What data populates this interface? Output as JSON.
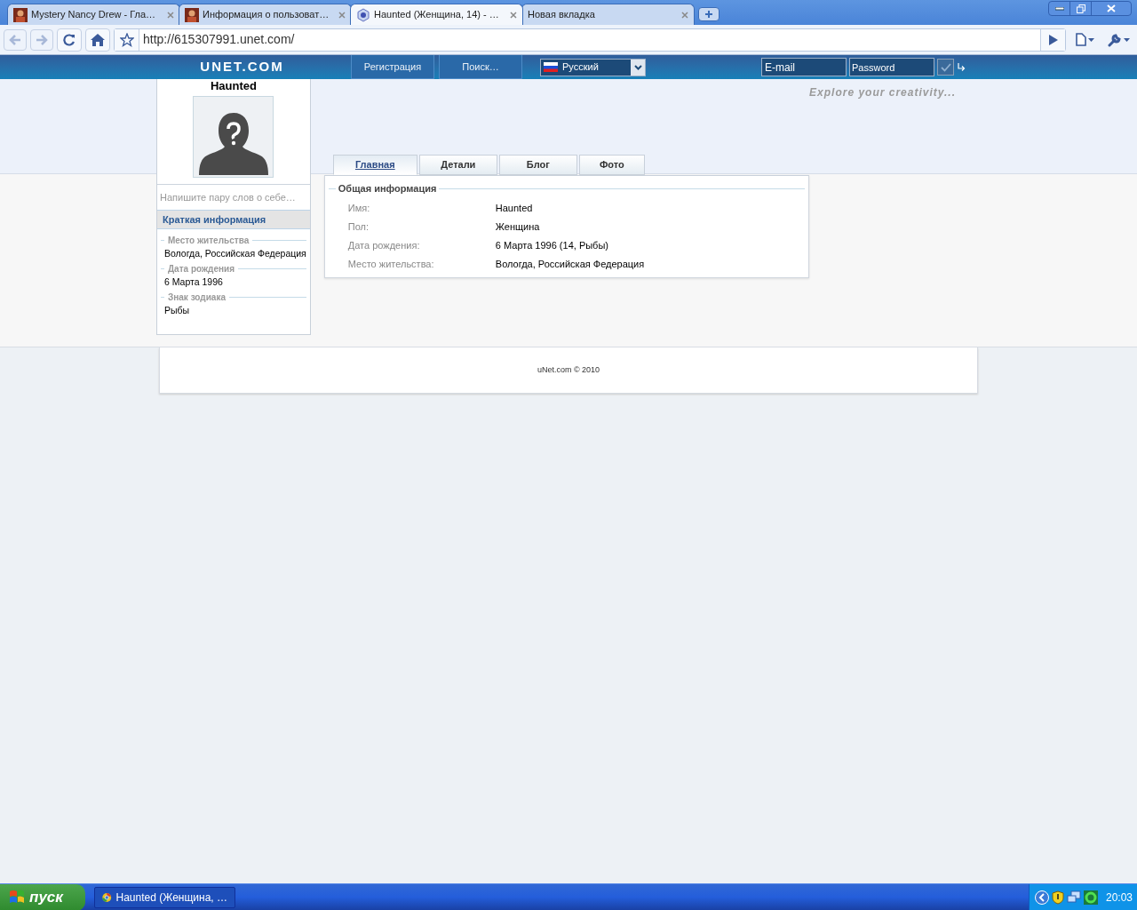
{
  "browser": {
    "tabs": [
      {
        "title": "Mystery Nancy Drew - Гла…",
        "kind": "portrait",
        "selected": false
      },
      {
        "title": "Информация о пользоват…",
        "kind": "portrait",
        "selected": false
      },
      {
        "title": "Haunted (Женщина, 14) - …",
        "kind": "site",
        "selected": true
      },
      {
        "title": "Новая вкладка",
        "kind": "blank",
        "selected": false
      }
    ],
    "url": "http://615307991.unet.com/"
  },
  "site": {
    "logo": "UNET.COM",
    "nav": [
      "Регистрация",
      "Поиск…"
    ],
    "language": "Русский",
    "email": {
      "placeholder": "E-mail"
    },
    "password": {
      "placeholder": "Password"
    },
    "slogan": "Explore your creativity..."
  },
  "profile": {
    "name": "Haunted",
    "about": {
      "placeholder": "Напишите пару слов о себе…"
    },
    "summary_title": "Краткая информация",
    "fields": [
      {
        "label": "Место жительства",
        "value": "Вологда, Российская Федерация"
      },
      {
        "label": "Дата рождения",
        "value": "6 Марта 1996"
      },
      {
        "label": "Знак зодиака",
        "value": "Рыбы"
      }
    ]
  },
  "tabs": [
    {
      "label": "Главная",
      "selected": true
    },
    {
      "label": "Детали",
      "selected": false
    },
    {
      "label": "Блог",
      "selected": false
    },
    {
      "label": "Фото",
      "selected": false
    }
  ],
  "section": {
    "title": "Общая информация",
    "rows": [
      {
        "label": "Имя:",
        "value": "Haunted"
      },
      {
        "label": "Пол:",
        "value": "Женщина"
      },
      {
        "label": "Дата рождения:",
        "value": "6 Марта 1996 (14, Рыбы)"
      },
      {
        "label": "Место жительства:",
        "value": "Вологда, Российская Федерация"
      }
    ]
  },
  "footer": "uNet.com © 2010",
  "taskbar": {
    "start": "пуск",
    "task": "Haunted (Женщина, …",
    "clock": "20:03"
  }
}
